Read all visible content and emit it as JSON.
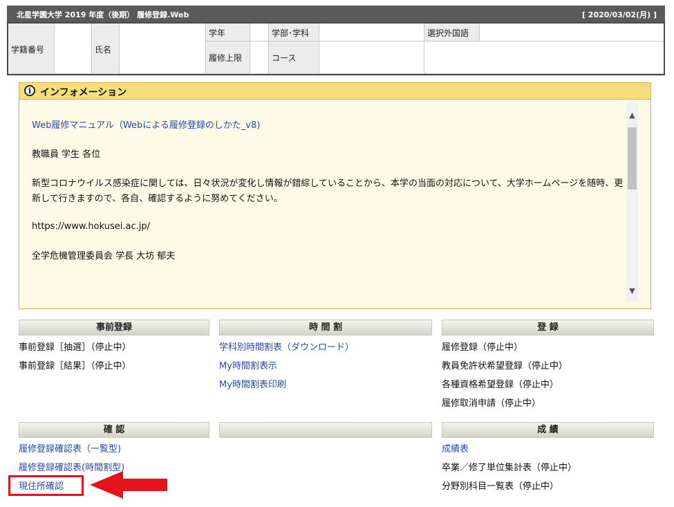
{
  "header": {
    "title": "北星学園大学 2019 年度（後期） 履修登録.Web",
    "date": "[ 2020/03/02(月) ]"
  },
  "student": {
    "id_label": "学籍番号",
    "name_label": "氏名",
    "year_label": "学年",
    "dept_label": "学部･学科",
    "lang_label": "選択外国語",
    "limit_label": "履修上限",
    "course_label": "コース"
  },
  "info": {
    "title": "インフォメーション",
    "manual_link": "Web履修マニュアル（Webによる履修登録のしかた_v8)",
    "greeting": "教職員 学生 各位",
    "notice": "新型コロナウイルス感染症に関しては、日々状況が変化し情報が錯綜していることから、本学の当面の対応について、大学ホームページを随時、更新して行きますので、各自、確認するように努めてください。",
    "url": "https://www.hokusei.ac.jp/",
    "signature": "全学危機管理委員会 学長 大坊 郁夫"
  },
  "menus": {
    "pre": {
      "title": "事前登録",
      "items": [
        "事前登録［抽選］（停止中）",
        "事前登録［結果］（停止中）"
      ]
    },
    "timetable": {
      "title": "時 間 割",
      "items": [
        "学科別時間割表（ダウンロード）",
        "My時間割表示",
        "My時間割表印刷"
      ]
    },
    "register": {
      "title": "登 録",
      "items": [
        "履修登録（停止中）",
        "教員免許状希望登録（停止中）",
        "各種資格希望登録（停止中）",
        "履修取消申請（停止中）"
      ]
    },
    "confirm": {
      "title": "確 認",
      "items": [
        "履修登録確認表（一覧型)",
        "履修登録確認表(時間割型)",
        "現住所確認"
      ]
    },
    "grades": {
      "title": "成 績",
      "items": [
        "成績表",
        "卒業／修了単位集計表（停止中）",
        "分野別科目一覧表（停止中）"
      ]
    }
  },
  "colors": {
    "link": "#2b4aa8",
    "highlight": "#e5141c",
    "panel_header": "#f5dd7c",
    "titlebar": "#5a5a5a"
  }
}
